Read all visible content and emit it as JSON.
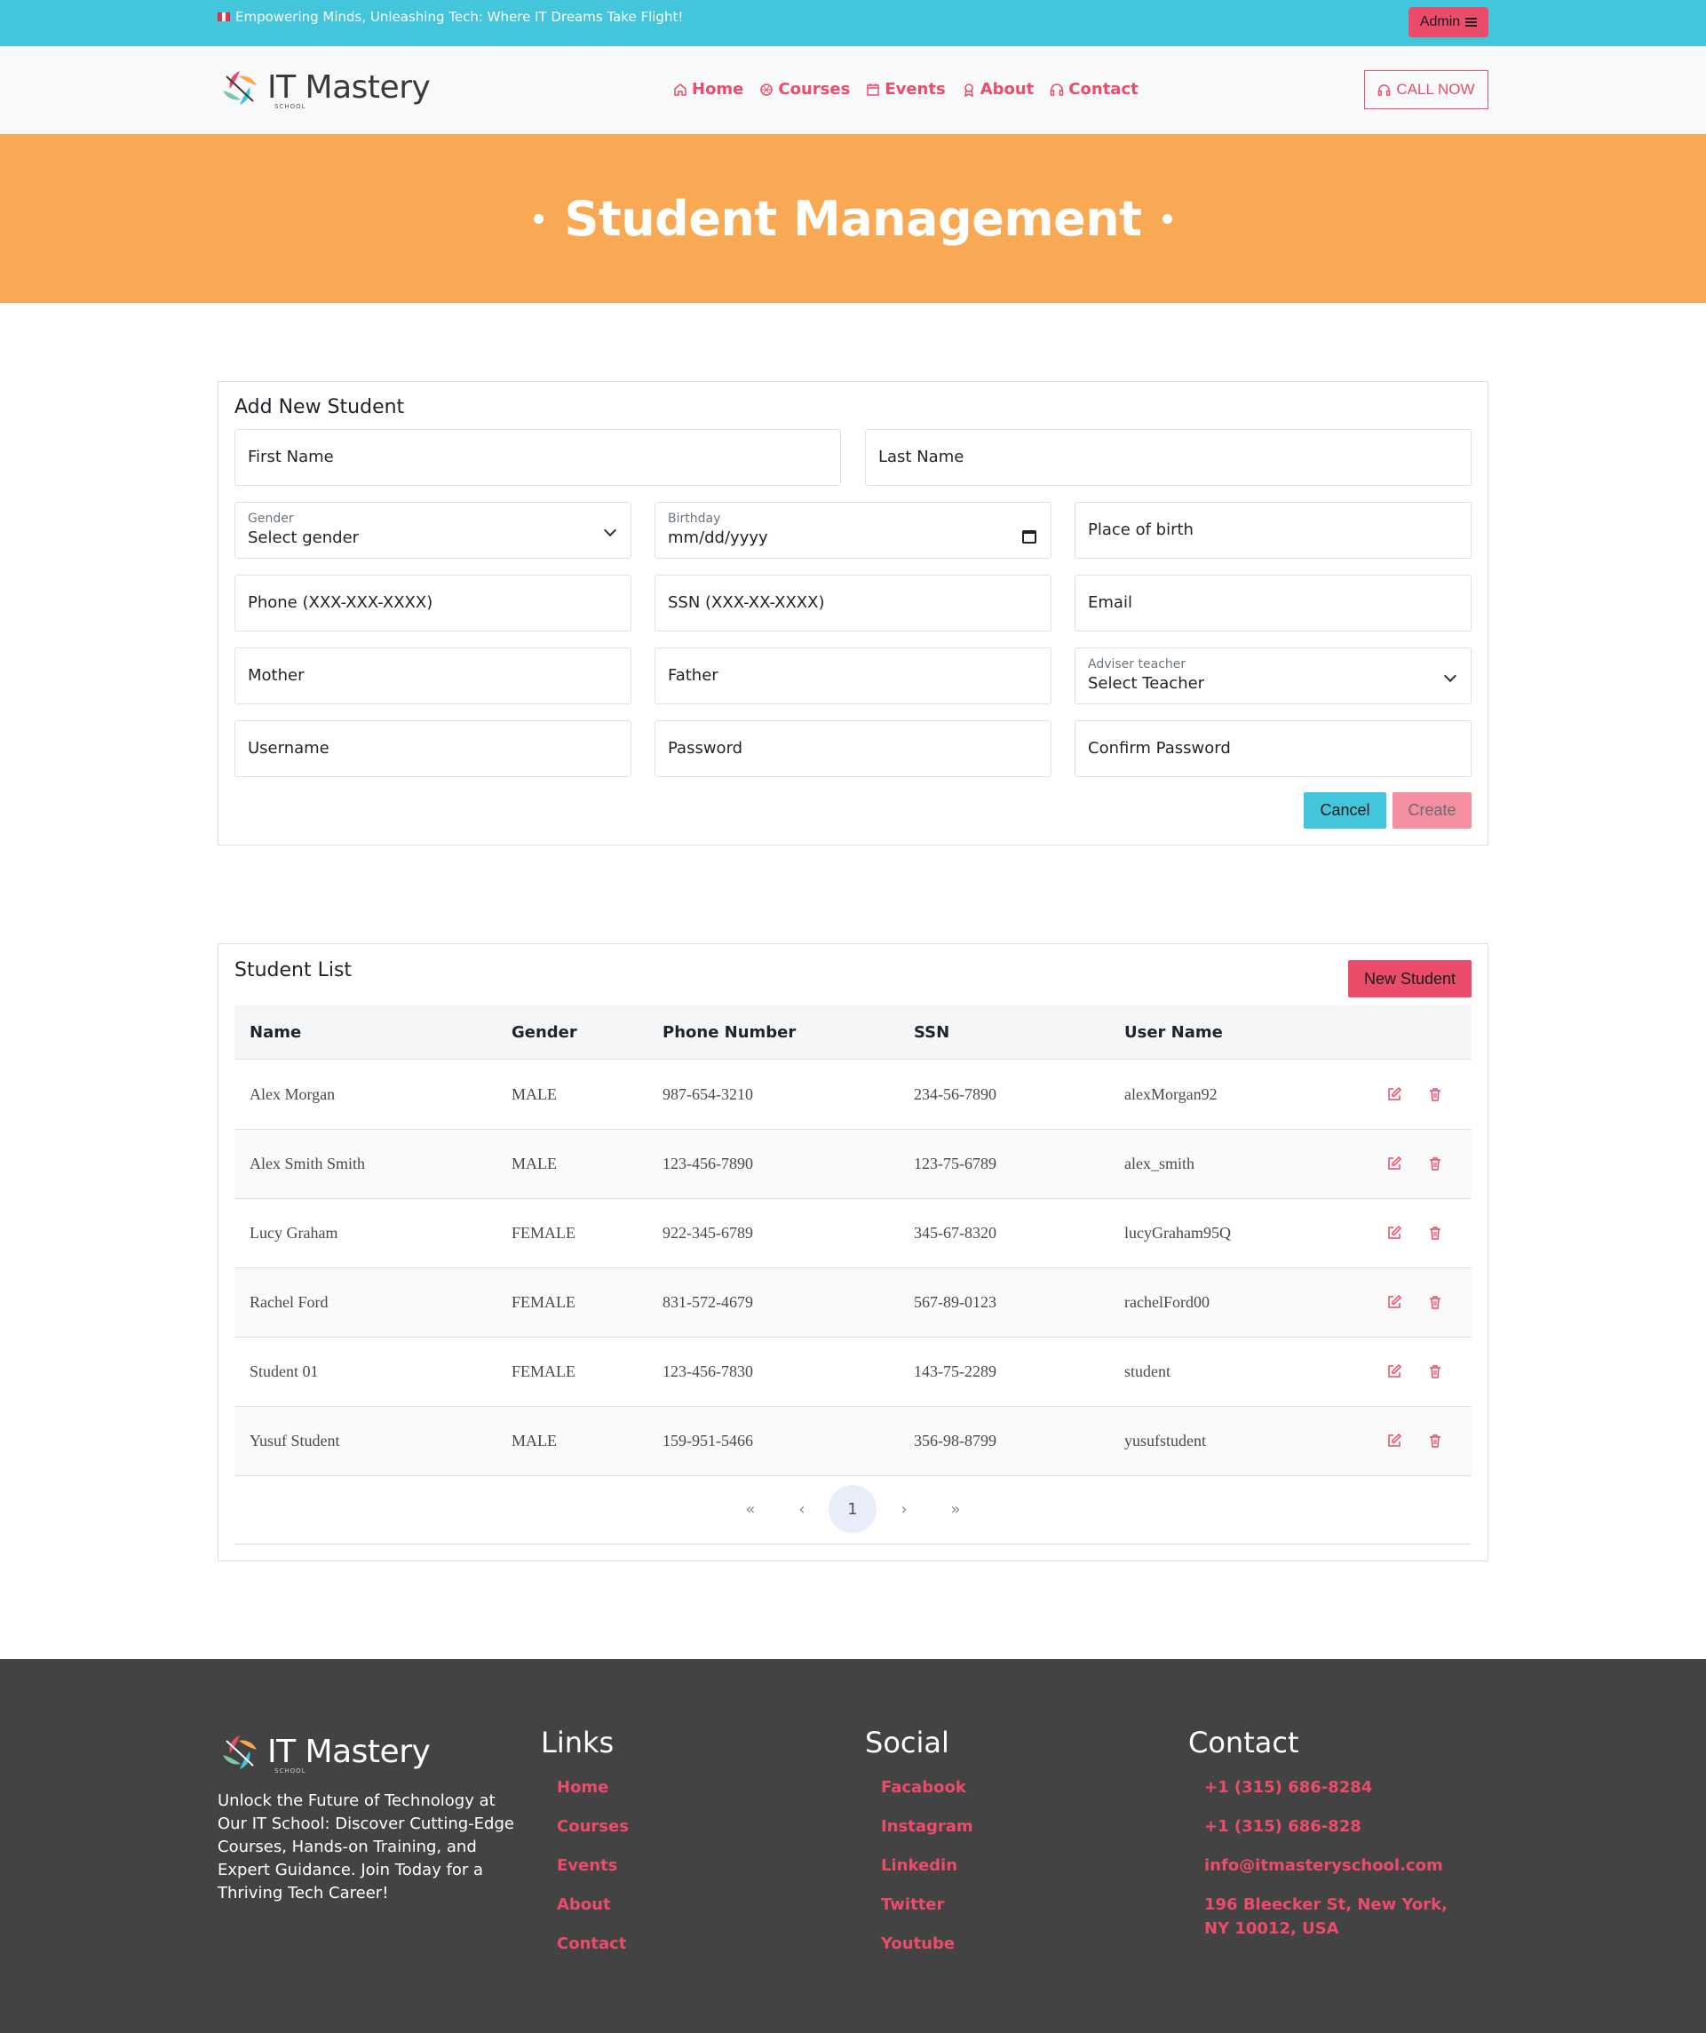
{
  "topbar": {
    "slogan": "Empowering Minds, Unleashing Tech: Where IT Dreams Take Flight!",
    "admin_label": "Admin"
  },
  "brand": {
    "name": "IT Mastery",
    "sub": "SCHOOL"
  },
  "nav": {
    "items": [
      {
        "label": "Home",
        "icon": "home-icon"
      },
      {
        "label": "Courses",
        "icon": "aperture-icon"
      },
      {
        "label": "Events",
        "icon": "calendar-icon"
      },
      {
        "label": "About",
        "icon": "award-icon"
      },
      {
        "label": "Contact",
        "icon": "headset-icon"
      }
    ],
    "call_label": "CALL NOW"
  },
  "banner": {
    "title": "Student Management"
  },
  "form": {
    "title": "Add New Student",
    "first_name": "First Name",
    "last_name": "Last Name",
    "gender_label": "Gender",
    "gender_value": "Select gender",
    "birthday_label": "Birthday",
    "birthday_value": "mm/dd/yyyy",
    "place_of_birth": "Place of birth",
    "phone": "Phone (XXX-XXX-XXXX)",
    "ssn": "SSN (XXX-XX-XXXX)",
    "email": "Email",
    "mother": "Mother",
    "father": "Father",
    "adviser_label": "Adviser teacher",
    "adviser_value": "Select Teacher",
    "username": "Username",
    "password": "Password",
    "confirm_password": "Confirm Password",
    "cancel_label": "Cancel",
    "create_label": "Create"
  },
  "list": {
    "title": "Student List",
    "new_label": "New Student",
    "columns": [
      "Name",
      "Gender",
      "Phone Number",
      "SSN",
      "User Name"
    ],
    "rows": [
      [
        "Alex Morgan",
        "MALE",
        "987-654-3210",
        "234-56-7890",
        "alexMorgan92"
      ],
      [
        "Alex Smith Smith",
        "MALE",
        "123-456-7890",
        "123-75-6789",
        "alex_smith"
      ],
      [
        "Lucy Graham",
        "FEMALE",
        "922-345-6789",
        "345-67-8320",
        "lucyGraham95Q"
      ],
      [
        "Rachel Ford",
        "FEMALE",
        "831-572-4679",
        "567-89-0123",
        "rachelFord00"
      ],
      [
        "Student 01",
        "FEMALE",
        "123-456-7830",
        "143-75-2289",
        "student"
      ],
      [
        "Yusuf Student",
        "MALE",
        "159-951-5466",
        "356-98-8799",
        "yusufstudent"
      ]
    ],
    "pager": {
      "first": "«",
      "prev": "‹",
      "current": "1",
      "next": "›",
      "last": "»"
    }
  },
  "footer": {
    "description": "Unlock the Future of Technology at Our IT School: Discover Cutting-Edge Courses, Hands-on Training, and Expert Guidance. Join Today for a Thriving Tech Career!",
    "links_title": "Links",
    "links": [
      "Home",
      "Courses",
      "Events",
      "About",
      "Contact"
    ],
    "social_title": "Social",
    "social": [
      "Facabook",
      "Instagram",
      "Linkedin",
      "Twitter",
      "Youtube"
    ],
    "contact_title": "Contact",
    "contact": [
      "+1 (315) 686-8284",
      "+1 (315) 686-828",
      "info@itmasteryschool.com",
      "196 Bleecker St, New York, NY 10012, USA"
    ]
  },
  "colors": {
    "accent": "#ea4c6a",
    "topbar": "#43c5db",
    "banner": "#f9a953",
    "footer": "#434343"
  }
}
